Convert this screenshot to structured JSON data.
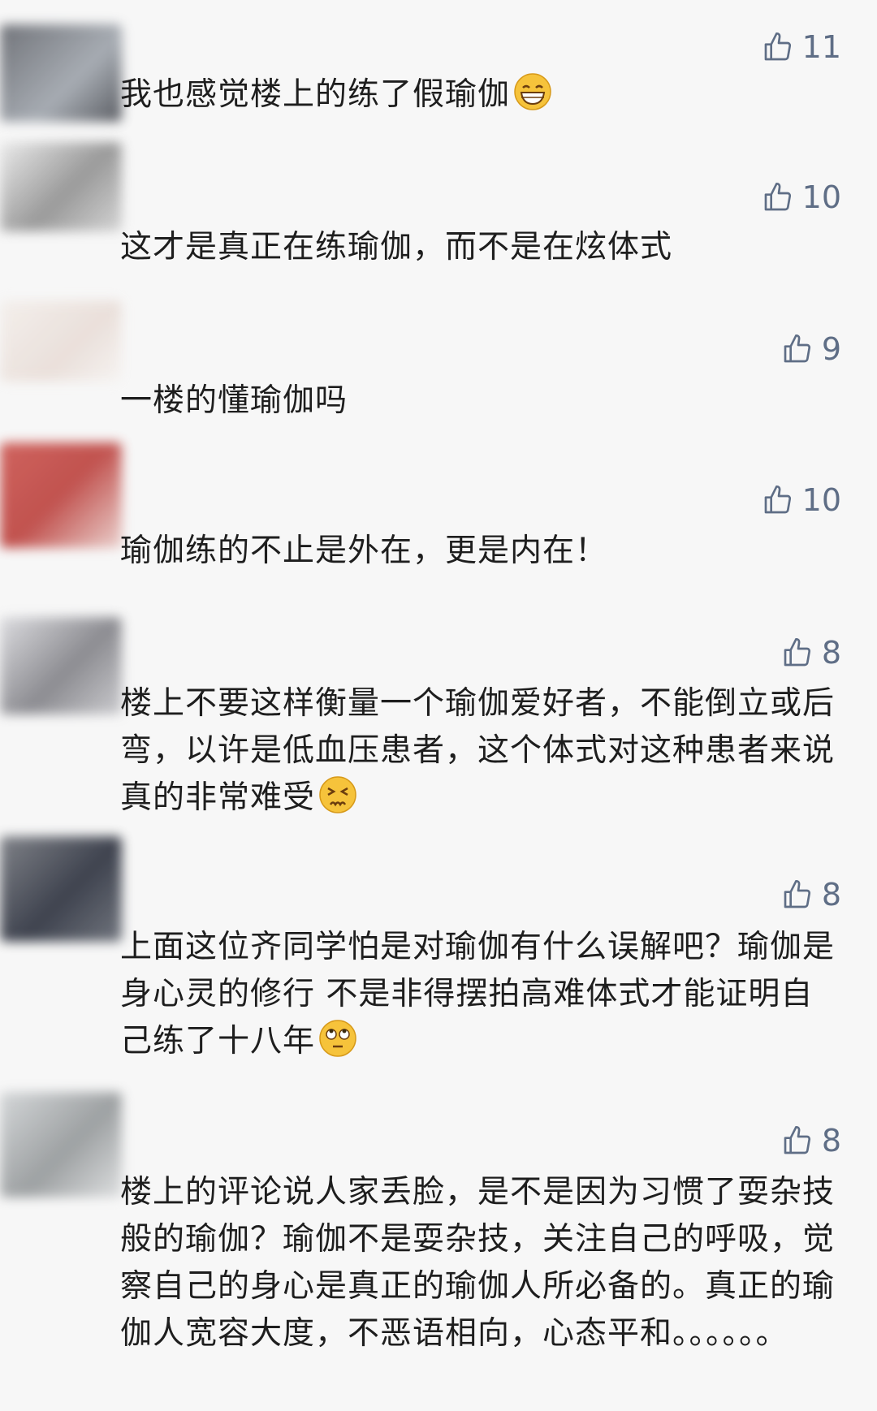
{
  "comments": [
    {
      "likes": "11",
      "text": "我也感觉楼上的练了假瑜伽",
      "emoji": "grinning-face-emoji"
    },
    {
      "likes": "10",
      "text": "这才是真正在练瑜伽，而不是在炫体式",
      "emoji": ""
    },
    {
      "likes": "9",
      "text": "一楼的懂瑜伽吗",
      "emoji": ""
    },
    {
      "likes": "10",
      "text": "瑜伽练的不止是外在，更是内在！",
      "emoji": ""
    },
    {
      "likes": "8",
      "text": "楼上不要这样衡量一个瑜伽爱好者，不能倒立或后弯，以许是低血压患者，这个体式对这种患者来说真的非常难受",
      "emoji": "persevering-face-emoji"
    },
    {
      "likes": "8",
      "text": "上面这位齐同学怕是对瑜伽有什么误解吧？瑜伽是身心灵的修行 不是非得摆拍高难体式才能证明自己练了十八年",
      "emoji": "eye-roll-face-emoji"
    },
    {
      "likes": "8",
      "text": "楼上的评论说人家丢脸，是不是因为习惯了耍杂技般的瑜伽？瑜伽不是耍杂技，关注自己的呼吸，觉察自己的身心是真正的瑜伽人所必备的。真正的瑜伽人宽容大度，不恶语相向，心态平和。。。。。。",
      "emoji": ""
    }
  ],
  "colors": {
    "background": "#f7f7f7",
    "like": "#5f6e86",
    "text": "#1e1e1e"
  }
}
